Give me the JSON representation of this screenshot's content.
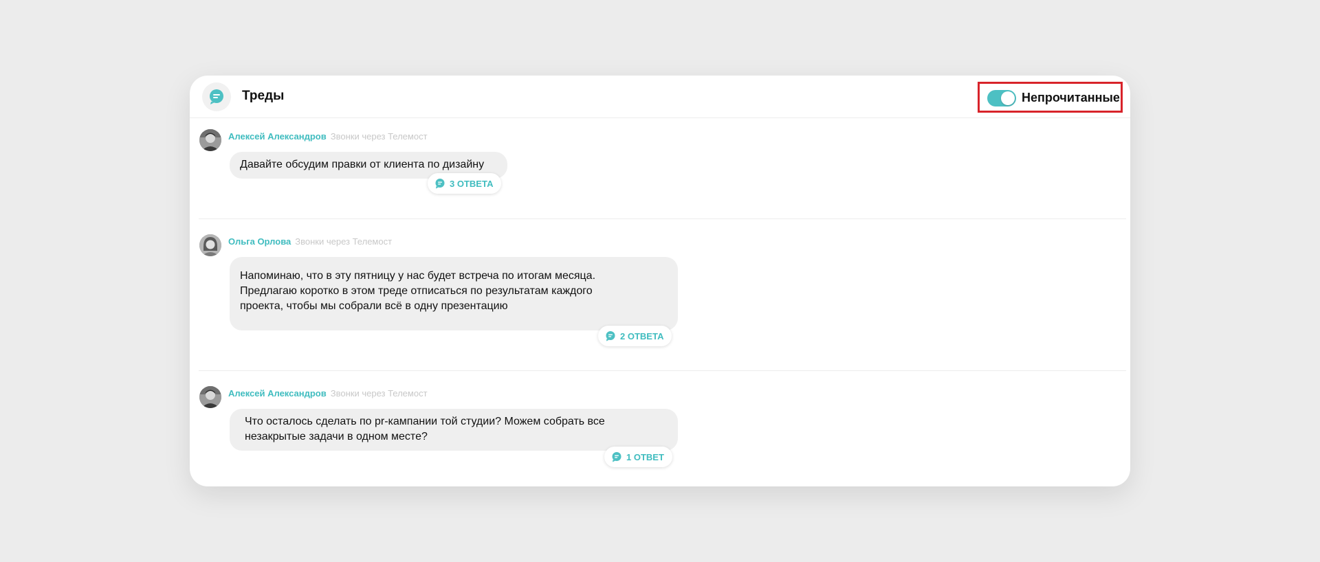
{
  "header": {
    "title": "Треды",
    "app_icon": "chat-bubble-icon",
    "unread_filter": {
      "label": "Непрочитанные",
      "enabled": true
    }
  },
  "colors": {
    "accent": "#4dc0c3",
    "highlight_frame": "#d8232a",
    "bubble_bg": "#efefef",
    "muted_text": "#c8c8c8"
  },
  "threads": [
    {
      "author": "Алексей Александров",
      "channel": "Звонки через Телемост",
      "lines": [
        "Давайте обсудим правки от клиента по дизайну"
      ],
      "replies": "3 ОТВЕТА"
    },
    {
      "author": "Ольга Орлова",
      "channel": "Звонки через Телемост",
      "lines": [
        "Напоминаю, что в эту пятницу у нас будет встреча по итогам месяца.",
        "Предлагаю коротко в этом треде отписаться по результатам каждого",
        "проекта, чтобы мы собрали всё в одну презентацию"
      ],
      "replies": "2 ОТВЕТА"
    },
    {
      "author": "Алексей Александров",
      "channel": "Звонки через Телемост",
      "lines": [
        "Что осталось сделать по pr-кампании той студии? Можем собрать все",
        "незакрытые задачи в одном месте?"
      ],
      "replies": "1 ОТВЕТ"
    }
  ]
}
